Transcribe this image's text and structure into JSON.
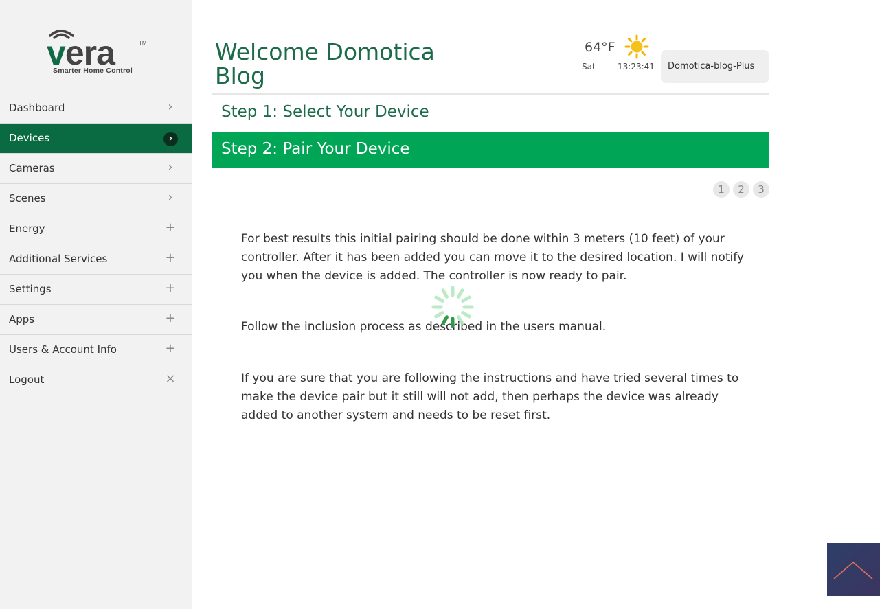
{
  "logo": {
    "name": "Vera",
    "tagline": "Smarter Home Control"
  },
  "sidebar": {
    "items": [
      {
        "label": "Dashboard",
        "icon": "chevron-right-icon",
        "symbol": "›"
      },
      {
        "label": "Devices",
        "icon": "chevron-right-icon",
        "symbol": "›",
        "active": true
      },
      {
        "label": "Cameras",
        "icon": "chevron-right-icon",
        "symbol": "›"
      },
      {
        "label": "Scenes",
        "icon": "chevron-right-icon",
        "symbol": "›"
      },
      {
        "label": "Energy",
        "icon": "plus-icon",
        "symbol": "+"
      },
      {
        "label": "Additional Services",
        "icon": "plus-icon",
        "symbol": "+"
      },
      {
        "label": "Settings",
        "icon": "plus-icon",
        "symbol": "+"
      },
      {
        "label": "Apps",
        "icon": "plus-icon",
        "symbol": "+"
      },
      {
        "label": "Users & Account Info",
        "icon": "plus-icon",
        "symbol": "+"
      },
      {
        "label": "Logout",
        "icon": "close-icon",
        "symbol": "×"
      }
    ]
  },
  "header": {
    "welcome": "Welcome Domotica Blog",
    "weather": {
      "temperature": "64°F",
      "icon": "sun-icon",
      "day": "Sat",
      "time": "13:23:41"
    },
    "account": "Domotica-blog-Plus"
  },
  "wizard": {
    "step1": "Step 1: Select Your Device",
    "step2": "Step 2: Pair Your Device",
    "pages": [
      "1",
      "2",
      "3"
    ],
    "paragraphs": [
      "For best results this initial pairing should be done within 3 meters (10 feet) of your controller. After it has been added you can move it to the desired location. I will notify you when the device is added. The controller is now ready to pair.",
      "Follow the inclusion process as described in the users manual.",
      "If you are sure that you are following the instructions and have tried several times to make the device pair but it still will not add, then perhaps the device was already added to another system and needs to be reset first."
    ]
  },
  "colors": {
    "brand_green": "#0a6a41",
    "step_active": "#00a556",
    "heading_green": "#1d6b4b",
    "scroll_button": "#2e3f68"
  },
  "icons": {
    "spinner": "loading-spinner-icon",
    "scroll_top": "chevron-up-icon"
  }
}
